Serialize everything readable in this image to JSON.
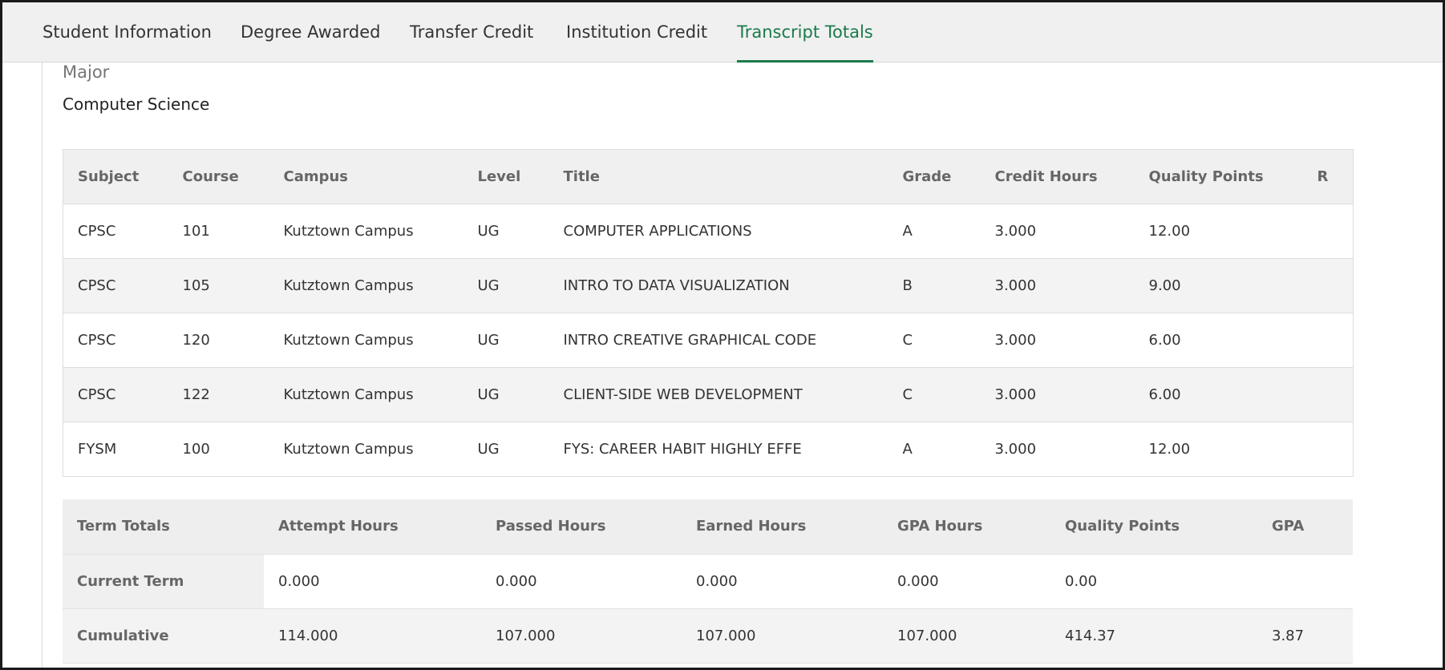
{
  "tabs": [
    {
      "label": "Student Information",
      "active": false
    },
    {
      "label": "Degree Awarded",
      "active": false
    },
    {
      "label": "Transfer Credit",
      "active": false
    },
    {
      "label": "Institution Credit",
      "active": false
    },
    {
      "label": "Transcript Totals",
      "active": true
    }
  ],
  "colors": {
    "accent": "#1a7a4c",
    "header_bg": "#f0f0f0",
    "alt_row_bg": "#f3f3f3"
  },
  "major": {
    "label": "Major",
    "value": "Computer Science"
  },
  "courses": {
    "columns": [
      "Subject",
      "Course",
      "Campus",
      "Level",
      "Title",
      "Grade",
      "Credit Hours",
      "Quality Points",
      "R"
    ],
    "rows": [
      [
        "CPSC",
        "101",
        "Kutztown Campus",
        "UG",
        "COMPUTER APPLICATIONS",
        "A",
        "3.000",
        "12.00",
        ""
      ],
      [
        "CPSC",
        "105",
        "Kutztown Campus",
        "UG",
        "INTRO TO DATA VISUALIZATION",
        "B",
        "3.000",
        "9.00",
        ""
      ],
      [
        "CPSC",
        "120",
        "Kutztown Campus",
        "UG",
        "INTRO CREATIVE GRAPHICAL CODE",
        "C",
        "3.000",
        "6.00",
        ""
      ],
      [
        "CPSC",
        "122",
        "Kutztown Campus",
        "UG",
        "CLIENT-SIDE WEB DEVELOPMENT",
        "C",
        "3.000",
        "6.00",
        ""
      ],
      [
        "FYSM",
        "100",
        "Kutztown Campus",
        "UG",
        "FYS: CAREER HABIT HIGHLY EFFE",
        "A",
        "3.000",
        "12.00",
        ""
      ]
    ]
  },
  "totals": {
    "columns": [
      "Term Totals",
      "Attempt Hours",
      "Passed Hours",
      "Earned Hours",
      "GPA Hours",
      "Quality Points",
      "GPA"
    ],
    "rows": [
      [
        "Current Term",
        "0.000",
        "0.000",
        "0.000",
        "0.000",
        "0.00",
        ""
      ],
      [
        "Cumulative",
        "114.000",
        "107.000",
        "107.000",
        "107.000",
        "414.37",
        "3.87"
      ]
    ]
  }
}
